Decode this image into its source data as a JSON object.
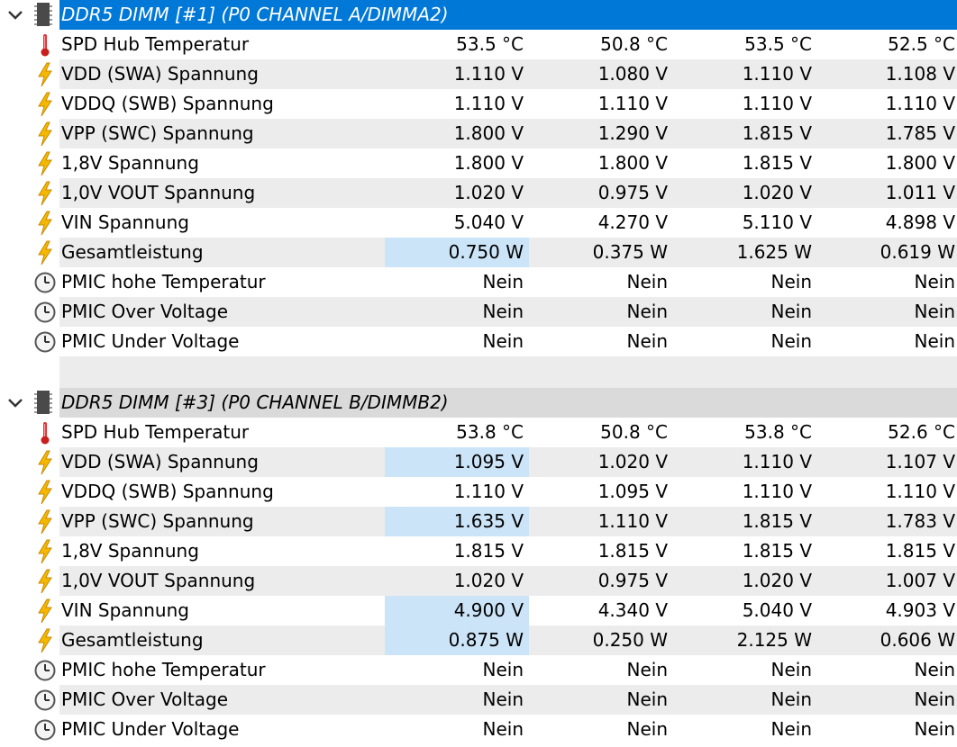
{
  "colors": {
    "selected_header_bg": "#0078d7",
    "unselected_header_bg": "#dadada",
    "alt_row_bg": "#ececec",
    "highlight_bg": "#cce4f7"
  },
  "groups": [
    {
      "title": "DDR5 DIMM [#1] (P0 CHANNEL A/DIMMA2)",
      "selected": true,
      "icon": "memory-chip-icon",
      "rows": [
        {
          "icon": "thermometer-icon",
          "label": "SPD Hub Temperatur",
          "values": [
            "53.5 °C",
            "50.8 °C",
            "53.5 °C",
            "52.5 °C"
          ],
          "highlight": false
        },
        {
          "icon": "lightning-icon",
          "label": "VDD (SWA) Spannung",
          "values": [
            "1.110 V",
            "1.080 V",
            "1.110 V",
            "1.108 V"
          ],
          "highlight": false
        },
        {
          "icon": "lightning-icon",
          "label": "VDDQ (SWB) Spannung",
          "values": [
            "1.110 V",
            "1.110 V",
            "1.110 V",
            "1.110 V"
          ],
          "highlight": false
        },
        {
          "icon": "lightning-icon",
          "label": "VPP (SWC) Spannung",
          "values": [
            "1.800 V",
            "1.290 V",
            "1.815 V",
            "1.785 V"
          ],
          "highlight": false
        },
        {
          "icon": "lightning-icon",
          "label": "1,8V Spannung",
          "values": [
            "1.800 V",
            "1.800 V",
            "1.815 V",
            "1.800 V"
          ],
          "highlight": false
        },
        {
          "icon": "lightning-icon",
          "label": "1,0V VOUT Spannung",
          "values": [
            "1.020 V",
            "0.975 V",
            "1.020 V",
            "1.011 V"
          ],
          "highlight": false
        },
        {
          "icon": "lightning-icon",
          "label": "VIN Spannung",
          "values": [
            "5.040 V",
            "4.270 V",
            "5.110 V",
            "4.898 V"
          ],
          "highlight": false
        },
        {
          "icon": "lightning-icon",
          "label": "Gesamtleistung",
          "values": [
            "0.750 W",
            "0.375 W",
            "1.625 W",
            "0.619 W"
          ],
          "highlight": true
        },
        {
          "icon": "clock-icon",
          "label": "PMIC hohe Temperatur",
          "values": [
            "Nein",
            "Nein",
            "Nein",
            "Nein"
          ],
          "highlight": false
        },
        {
          "icon": "clock-icon",
          "label": "PMIC Over Voltage",
          "values": [
            "Nein",
            "Nein",
            "Nein",
            "Nein"
          ],
          "highlight": false
        },
        {
          "icon": "clock-icon",
          "label": "PMIC Under Voltage",
          "values": [
            "Nein",
            "Nein",
            "Nein",
            "Nein"
          ],
          "highlight": false
        }
      ]
    },
    {
      "title": "DDR5 DIMM [#3] (P0 CHANNEL B/DIMMB2)",
      "selected": false,
      "icon": "memory-chip-icon",
      "rows": [
        {
          "icon": "thermometer-icon",
          "label": "SPD Hub Temperatur",
          "values": [
            "53.8 °C",
            "50.8 °C",
            "53.8 °C",
            "52.6 °C"
          ],
          "highlight": false
        },
        {
          "icon": "lightning-icon",
          "label": "VDD (SWA) Spannung",
          "values": [
            "1.095 V",
            "1.020 V",
            "1.110 V",
            "1.107 V"
          ],
          "highlight": true
        },
        {
          "icon": "lightning-icon",
          "label": "VDDQ (SWB) Spannung",
          "values": [
            "1.110 V",
            "1.095 V",
            "1.110 V",
            "1.110 V"
          ],
          "highlight": false
        },
        {
          "icon": "lightning-icon",
          "label": "VPP (SWC) Spannung",
          "values": [
            "1.635 V",
            "1.110 V",
            "1.815 V",
            "1.783 V"
          ],
          "highlight": true
        },
        {
          "icon": "lightning-icon",
          "label": "1,8V Spannung",
          "values": [
            "1.815 V",
            "1.815 V",
            "1.815 V",
            "1.815 V"
          ],
          "highlight": false
        },
        {
          "icon": "lightning-icon",
          "label": "1,0V VOUT Spannung",
          "values": [
            "1.020 V",
            "0.975 V",
            "1.020 V",
            "1.007 V"
          ],
          "highlight": false
        },
        {
          "icon": "lightning-icon",
          "label": "VIN Spannung",
          "values": [
            "4.900 V",
            "4.340 V",
            "5.040 V",
            "4.903 V"
          ],
          "highlight": true
        },
        {
          "icon": "lightning-icon",
          "label": "Gesamtleistung",
          "values": [
            "0.875 W",
            "0.250 W",
            "2.125 W",
            "0.606 W"
          ],
          "highlight": true
        },
        {
          "icon": "clock-icon",
          "label": "PMIC hohe Temperatur",
          "values": [
            "Nein",
            "Nein",
            "Nein",
            "Nein"
          ],
          "highlight": false
        },
        {
          "icon": "clock-icon",
          "label": "PMIC Over Voltage",
          "values": [
            "Nein",
            "Nein",
            "Nein",
            "Nein"
          ],
          "highlight": false
        },
        {
          "icon": "clock-icon",
          "label": "PMIC Under Voltage",
          "values": [
            "Nein",
            "Nein",
            "Nein",
            "Nein"
          ],
          "highlight": false
        }
      ]
    }
  ]
}
